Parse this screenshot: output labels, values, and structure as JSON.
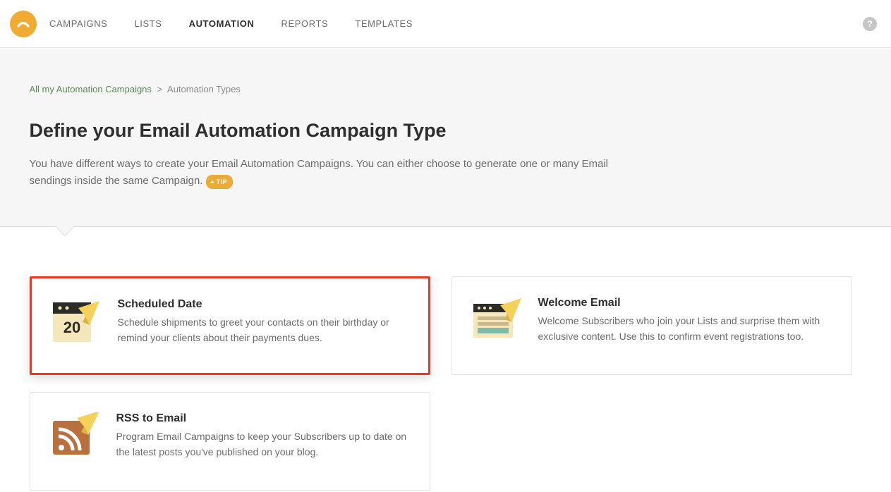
{
  "nav": {
    "items": [
      "CAMPAIGNS",
      "LISTS",
      "AUTOMATION",
      "REPORTS",
      "TEMPLATES"
    ],
    "active_index": 2
  },
  "breadcrumb": {
    "link": "All my Automation Campaigns",
    "current": "Automation Types"
  },
  "hero": {
    "title": "Define your Email Automation Campaign Type",
    "description": "You have different ways to create your Email Automation Campaigns. You can either choose to generate one or many Email sendings inside the same Campaign.",
    "tip_label": "TIP"
  },
  "cards": [
    {
      "title": "Scheduled Date",
      "description": "Schedule shipments to greet your contacts on their birthday or remind your clients about their payments dues.",
      "icon": "calendar-plane"
    },
    {
      "title": "Welcome Email",
      "description": "Welcome Subscribers who join your Lists and surprise them with exclusive content. Use this to confirm event registrations too.",
      "icon": "browser-plane"
    },
    {
      "title": "RSS to Email",
      "description": "Program Email Campaigns to keep your Subscribers up to date on the latest posts you've published on your blog.",
      "icon": "rss-plane"
    }
  ]
}
